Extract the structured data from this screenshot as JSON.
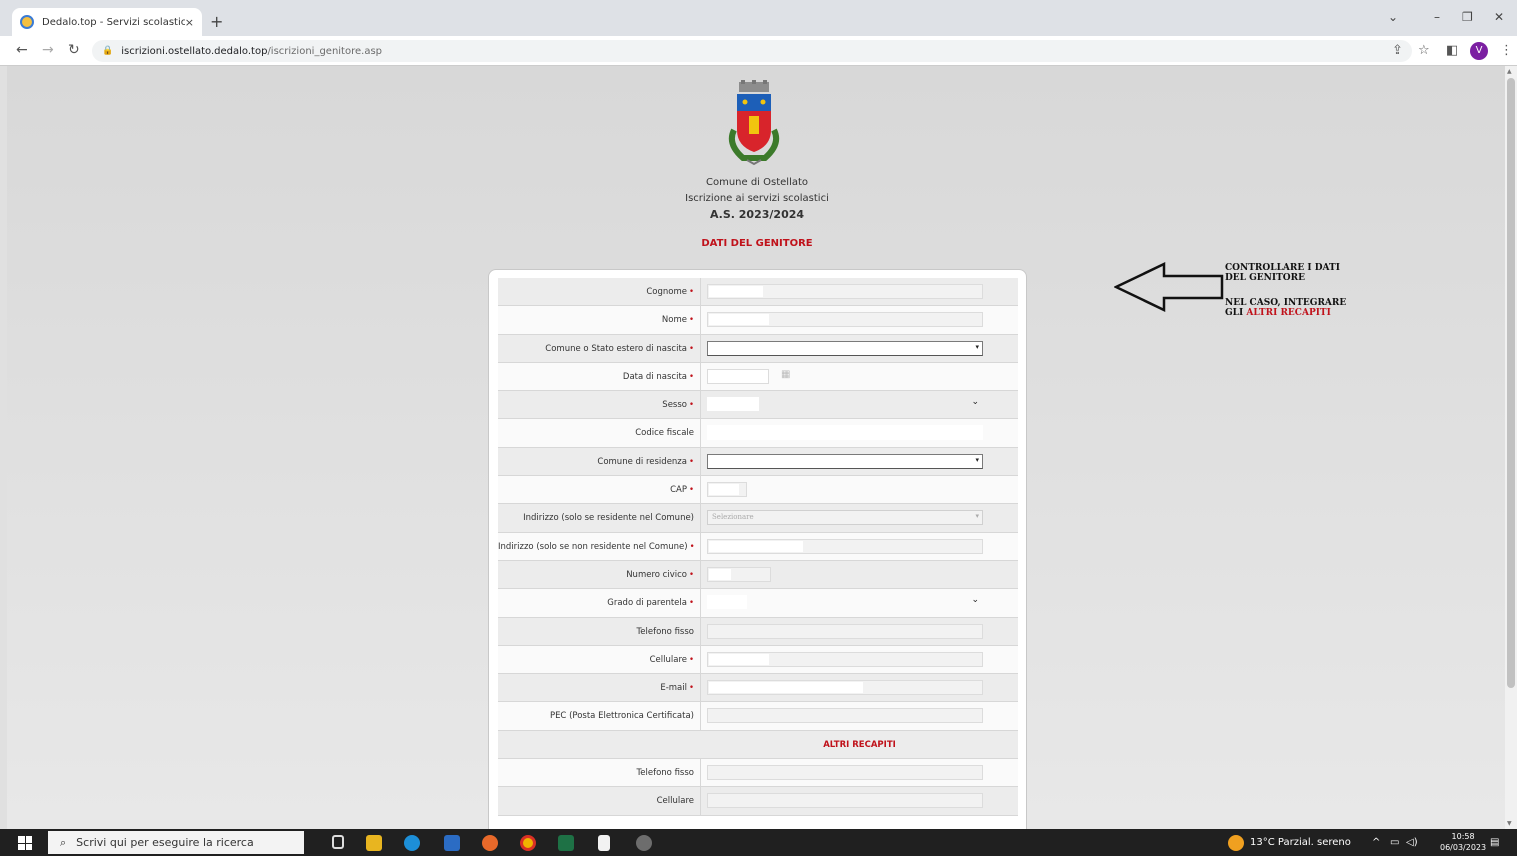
{
  "browser": {
    "tab_title": "Dedalo.top - Servizi scolastici",
    "tab_close": "×",
    "new_tab": "+",
    "url_host": "iscrizioni.ostellato.dedalo.top",
    "url_path": "/iscrizioni_genitore.asp",
    "profile_initial": "V"
  },
  "header": {
    "line1": "Comune di Ostellato",
    "line2": "Iscrizione ai servizi scolastici",
    "year": "A.S. 2023/2024",
    "section": "DATI DEL GENITORE"
  },
  "form": {
    "rows": [
      {
        "label": "Cognome",
        "required": "•"
      },
      {
        "label": "Nome",
        "required": "•"
      },
      {
        "label": "Comune o Stato estero di nascita",
        "required": "•"
      },
      {
        "label": "Data di nascita",
        "required": "•"
      },
      {
        "label": "Sesso",
        "required": "•"
      },
      {
        "label": "Codice fiscale"
      },
      {
        "label": "Comune di residenza",
        "required": "•"
      },
      {
        "label": "CAP",
        "required": "•"
      },
      {
        "label": "Indirizzo (solo se residente nel Comune)",
        "value": "Selezionare"
      },
      {
        "label": "Indirizzo (solo se non residente nel Comune)",
        "required": "•"
      },
      {
        "label": "Numero civico",
        "required": "•"
      },
      {
        "label": "Grado di parentela",
        "required": "•"
      },
      {
        "label": "Telefono fisso"
      },
      {
        "label": "Cellulare",
        "required": "•"
      },
      {
        "label": "E-mail",
        "required": "•"
      },
      {
        "label": "PEC (Posta Elettronica Certificata)"
      },
      {
        "heading": "ALTRI RECAPITI"
      },
      {
        "label": "Telefono fisso"
      },
      {
        "label": "Cellulare"
      }
    ]
  },
  "annotation": {
    "line1": "CONTROLLARE I DATI",
    "line2": "DEL GENITORE",
    "line3": "NEL CASO, INTEGRARE",
    "line4_prefix": "GLI ",
    "line4_red": "ALTRI RECAPITI"
  },
  "taskbar": {
    "search_placeholder": "Scrivi qui per eseguire la ricerca",
    "weather": "13°C Parzial. sereno",
    "time": "10:58",
    "date": "06/03/2023"
  },
  "colors": {
    "accent_red": "#c0121b",
    "taskbar": "#202020"
  }
}
